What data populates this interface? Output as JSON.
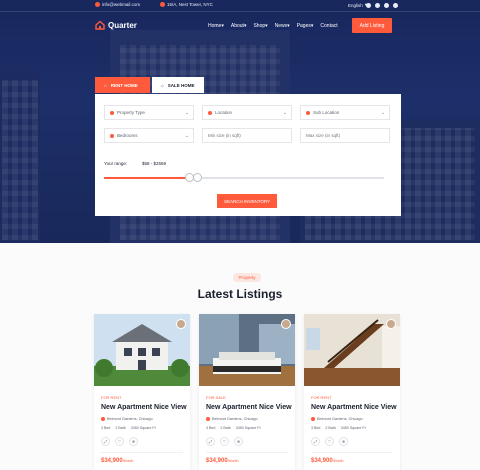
{
  "topbar": {
    "email": "info@webmail.com",
    "address": "15/A, Nest Tower, NYC",
    "language": "English"
  },
  "brand": {
    "name": "Quarter",
    "accent": "#ff5a3c"
  },
  "nav": {
    "items": [
      "Home",
      "About",
      "Shop",
      "News",
      "Pages",
      "Contact"
    ],
    "cta_label": "Add Listing"
  },
  "search": {
    "tabs": [
      {
        "label": "RENT HOME",
        "icon": "home-icon",
        "active": true
      },
      {
        "label": "SALE HOME",
        "icon": "home-icon",
        "active": false
      }
    ],
    "selects": {
      "property_type": "Property Type",
      "location": "Location",
      "sub_location": "Sub Location",
      "bedrooms": "Bedrooms"
    },
    "inputs": {
      "min_size_placeholder": "Min size (in sqft)",
      "max_size_placeholder": "Max size (in sqft)",
      "third_size_placeholder": "Max size (in sqft)"
    },
    "range": {
      "label": "Your range:",
      "value": "$58 - $2569",
      "fill_fraction": 0.3
    },
    "submit_label": "SEARCH INVENTORY"
  },
  "listings": {
    "pill": "Property",
    "heading": "Latest Listings",
    "cards": [
      {
        "status": "FOR RENT",
        "title": "New Apartment Nice View",
        "location": "Belmont Gardens, Chicago",
        "bed": "3 Bed",
        "bath": "2 Bath",
        "area": "3450 Square Ft",
        "price": "$34,900",
        "price_unit": "/Month"
      },
      {
        "status": "FOR SALE",
        "title": "New Apartment Nice View",
        "location": "Belmont Gardens, Chicago",
        "bed": "3 Bed",
        "bath": "2 Bath",
        "area": "3450 Square Ft",
        "price": "$34,900",
        "price_unit": "/Month"
      },
      {
        "status": "FOR RENT",
        "title": "New Apartment Nice View",
        "location": "Belmont Gardens, Chicago",
        "bed": "3 Bed",
        "bath": "2 Bath",
        "area": "3450 Square Ft",
        "price": "$34,900",
        "price_unit": "/Month"
      }
    ]
  }
}
